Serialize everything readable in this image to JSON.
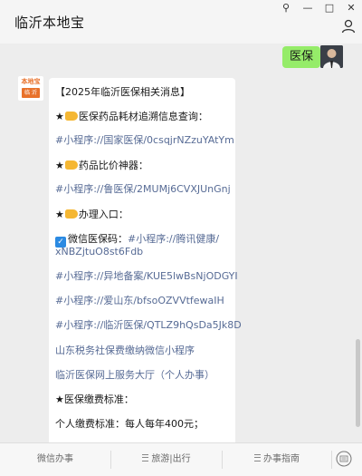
{
  "window": {
    "title": "临沂本地宝",
    "buttons": {
      "pin": "⚲",
      "minimize": "—",
      "maximize": "□",
      "close": "✕"
    }
  },
  "chat": {
    "user_message": "医保",
    "bot_avatar": {
      "top": "本地宝",
      "bottom": "临 沂"
    },
    "bot_lines": [
      "【2025年临沂医保相关消息】",
      "医保药品耗材追溯信息查询：",
      "#小程序://国家医保/0csqjrNZzuYAtYm",
      "药品比价神器：",
      "#小程序://鲁医保/2MUMj6CVXJUnGnj",
      "办理入口：",
      "微信医保码：",
      "#小程序://腾讯健康/",
      "xNBZjtuO8st6Fdb",
      "#小程序://异地备案/KUE5lwBsNjODGYI",
      "#小程序://爱山东/bfsoOZVVtfewaIH",
      "#小程序://临沂医保/QTLZ9hQsDa5Jk8D",
      "山东税务社保费缴纳微信小程序",
      "临沂医保网上服务大厅（个人办事）",
      "医保缴费标准：",
      "个人缴费标准：每人每年400元；"
    ],
    "star": "★"
  },
  "bottom_menu": [
    "微信办事",
    "旅游|出行",
    "办事指南"
  ],
  "colors": {
    "user_bubble": "#95ec69",
    "link": "#576b95",
    "accent": "#e8712a"
  },
  "icons": {
    "pin": "pin-icon",
    "person": "person-icon",
    "menu": "menu-lines-icon",
    "keyboard": "keyboard-icon"
  }
}
